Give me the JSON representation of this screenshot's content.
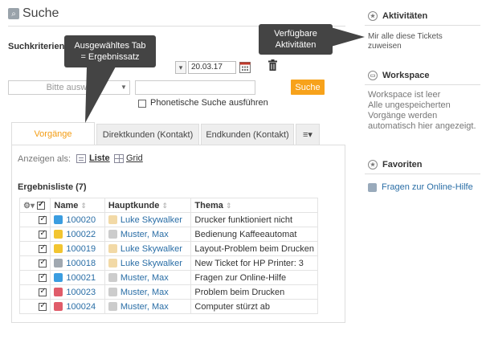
{
  "header": {
    "title": "Suche",
    "title_icon": "search-icon"
  },
  "search": {
    "criteria_label": "Suchkriterien",
    "date_to": "20.03.17",
    "select_placeholder": "Bitte auswä",
    "text_value": "",
    "search_button": "Suche",
    "phonetic_label": "Phonetische Suche ausführen"
  },
  "tabs": [
    {
      "label": "Vorgänge",
      "active": true
    },
    {
      "label": "Direktkunden (Kontakt)",
      "active": false
    },
    {
      "label": "Endkunden (Kontakt)",
      "active": false
    }
  ],
  "view": {
    "label": "Anzeigen als:",
    "list": "Liste",
    "grid": "Grid"
  },
  "results": {
    "title": "Ergebnisliste (7)",
    "columns": [
      "Name",
      "Hauptkunde",
      "Thema"
    ],
    "rows": [
      {
        "id": "100020",
        "icon_color": "#3b9de0",
        "customer": "Luke Skywalker",
        "topic": "Drucker funktioniert nicht"
      },
      {
        "id": "100022",
        "icon_color": "#f2c531",
        "customer": "Muster, Max",
        "topic": "Bedienung Kaffeeautomat"
      },
      {
        "id": "100019",
        "icon_color": "#f2c531",
        "customer": "Luke Skywalker",
        "topic": "Layout-Problem beim Drucken"
      },
      {
        "id": "100018",
        "icon_color": "#a0a8b0",
        "customer": "Luke Skywalker",
        "topic": "New Ticket for HP Printer: 3"
      },
      {
        "id": "100021",
        "icon_color": "#3b9de0",
        "customer": "Muster, Max",
        "topic": "Fragen zur Online-Hilfe"
      },
      {
        "id": "100023",
        "icon_color": "#e05c6a",
        "customer": "Muster, Max",
        "topic": "Problem beim Drucken"
      },
      {
        "id": "100024",
        "icon_color": "#e05c6a",
        "customer": "Muster, Max",
        "topic": "Computer stürzt ab"
      }
    ]
  },
  "callouts": {
    "tab_line1": "Ausgewähltes Tab",
    "tab_line2": "= Ergebnissatz",
    "act_line1": "Verfügbare",
    "act_line2": "Aktivitäten"
  },
  "sidebar": {
    "activities": {
      "title": "Aktivitäten",
      "item_line1": "Mir alle diese Tickets",
      "item_line2": "zuweisen"
    },
    "workspace": {
      "title": "Workspace",
      "line1": "Workspace ist leer",
      "line2": "Alle ungespeicherten",
      "line3": "Vorgänge werden",
      "line4": "automatisch hier angezeigt."
    },
    "favorites": {
      "title": "Favoriten",
      "item": "Fragen zur Online-Hilfe"
    }
  },
  "colors": {
    "accent": "#f39c12",
    "link": "#2a6ea6",
    "callout_bg": "#444444"
  }
}
